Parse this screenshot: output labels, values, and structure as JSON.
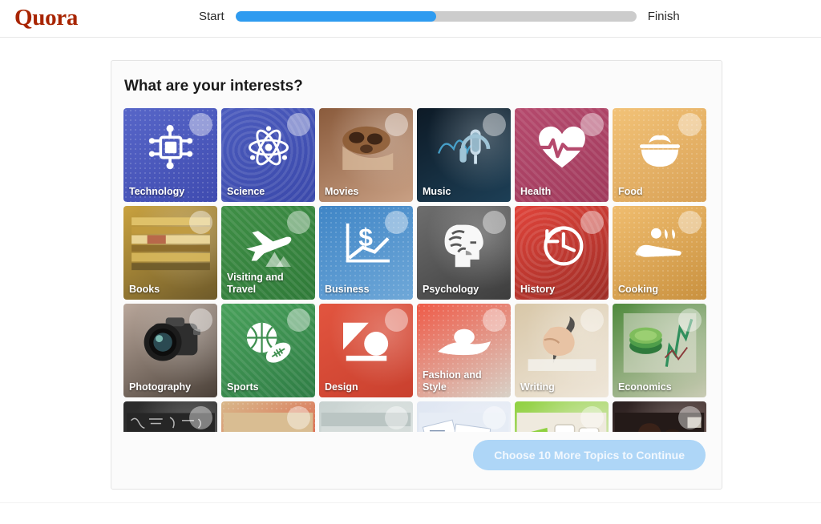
{
  "header": {
    "brand": "Quora",
    "brand_color": "#a82400",
    "progress": {
      "start_label": "Start",
      "finish_label": "Finish",
      "percent": 50,
      "fill_color": "#2e9bf0",
      "track_color": "#cccccc"
    }
  },
  "card": {
    "title": "What are your interests?",
    "continue_button": {
      "label": "Choose 10 More Topics to Continue",
      "remaining_count": 10,
      "enabled": false,
      "color": "#aed6f7"
    }
  },
  "topics": [
    {
      "label": "Technology",
      "icon": "microchip-icon",
      "bg_start": "#5766c8",
      "bg_end": "#3f4bb0",
      "texture": "tex-dots",
      "selector": "selector-circle",
      "visible": true
    },
    {
      "label": "Science",
      "icon": "atom-icon",
      "bg_start": "#4b5bbd",
      "bg_end": "#3b49ab",
      "texture": "tex-rings",
      "selector": "selector-circle",
      "visible": true
    },
    {
      "label": "Movies",
      "icon": "film-reel-photo",
      "bg_start": "#8a5b3c",
      "bg_end": "#c9a084",
      "texture": "tex-blur",
      "selector": "selector-circle",
      "visible": true
    },
    {
      "label": "Music",
      "icon": "microphone-photo",
      "bg_start": "#0d1a26",
      "bg_end": "#1d3f56",
      "texture": "tex-blur",
      "selector": "selector-circle",
      "visible": true
    },
    {
      "label": "Health",
      "icon": "heartbeat-icon",
      "bg_start": "#b54a6d",
      "bg_end": "#a03a5c",
      "texture": "tex-diag",
      "selector": "selector-circle",
      "visible": true
    },
    {
      "label": "Food",
      "icon": "rice-bowl-icon",
      "bg_start": "#f2c277",
      "bg_end": "#d9a257",
      "texture": "tex-dots",
      "selector": "selector-circle",
      "visible": true
    },
    {
      "label": "Books",
      "icon": "book-stack-photo",
      "bg_start": "#c9a23f",
      "bg_end": "#6e5a2a",
      "texture": "tex-blur",
      "selector": "selector-circle",
      "visible": true
    },
    {
      "label": "Visiting and Travel",
      "icon": "airplane-icon",
      "bg_start": "#3f8f46",
      "bg_end": "#2f7a38",
      "texture": "tex-diag",
      "selector": "selector-circle",
      "visible": true
    },
    {
      "label": "Business",
      "icon": "dollar-chart-icon",
      "bg_start": "#3f85c6",
      "bg_end": "#6fa8d8",
      "texture": "tex-dots",
      "selector": "selector-circle",
      "visible": true
    },
    {
      "label": "Psychology",
      "icon": "brain-head-icon",
      "bg_start": "#6e6e6e",
      "bg_end": "#3d3d3d",
      "texture": "tex-blur",
      "selector": "selector-circle",
      "visible": true
    },
    {
      "label": "History",
      "icon": "clock-rewind-icon",
      "bg_start": "#e0443b",
      "bg_end": "#9e2d26",
      "texture": "tex-rings",
      "selector": "selector-circle",
      "visible": true
    },
    {
      "label": "Cooking",
      "icon": "knife-icon",
      "bg_start": "#f0bd6f",
      "bg_end": "#c9913f",
      "texture": "tex-dots",
      "selector": "selector-circle",
      "visible": true
    },
    {
      "label": "Photography",
      "icon": "camera-photo",
      "bg_start": "#b9a79b",
      "bg_end": "#4a4038",
      "texture": "tex-blur",
      "selector": "selector-circle",
      "visible": true
    },
    {
      "label": "Sports",
      "icon": "ball-icon",
      "bg_start": "#48a05a",
      "bg_end": "#2f7d45",
      "texture": "tex-diag",
      "selector": "selector-circle",
      "visible": true
    },
    {
      "label": "Design",
      "icon": "shapes-icon",
      "bg_start": "#e2553f",
      "bg_end": "#c9402e",
      "texture": "tex-blur",
      "selector": "selector-circle",
      "visible": true
    },
    {
      "label": "Fashion and Style",
      "icon": "sun-hat-icon",
      "bg_start": "#ef5a47",
      "bg_end": "#d8d2c8",
      "texture": "tex-dots",
      "selector": "selector-circle",
      "visible": true
    },
    {
      "label": "Writing",
      "icon": "hand-pen-photo",
      "bg_start": "#d8c7a8",
      "bg_end": "#efe7da",
      "texture": "tex-blur",
      "selector": "selector-circle",
      "visible": true
    },
    {
      "label": "Economics",
      "icon": "coins-chart-photo",
      "bg_start": "#4f8a3d",
      "bg_end": "#c9cbb4",
      "texture": "tex-blur",
      "selector": "selector-circle",
      "visible": true
    },
    {
      "label": "",
      "icon": "chalkboard-math-photo",
      "bg_start": "#2b2b2b",
      "bg_end": "#3a3a3a",
      "texture": "tex-blur",
      "selector": "selector-circle",
      "visible": true
    },
    {
      "label": "",
      "icon": "red-texture-photo",
      "bg_start": "#d8b88a",
      "bg_end": "#e03c2e",
      "texture": "tex-dots",
      "selector": "selector-circle",
      "visible": true
    },
    {
      "label": "",
      "icon": "pale-gray-photo",
      "bg_start": "#c8d2d0",
      "bg_end": "#e2e8e6",
      "texture": "tex-blur",
      "selector": "selector-circle",
      "visible": true
    },
    {
      "label": "",
      "icon": "documents-photo",
      "bg_start": "#dfe6f2",
      "bg_end": "#eef2f8",
      "texture": "tex-blur",
      "selector": "selector-circle",
      "visible": true
    },
    {
      "label": "",
      "icon": "keyboard-photo",
      "bg_start": "#8fd13f",
      "bg_end": "#efeade",
      "texture": "tex-blur",
      "selector": "selector-circle",
      "visible": true
    },
    {
      "label": "",
      "icon": "people-photo",
      "bg_start": "#2a2020",
      "bg_end": "#6b4a42",
      "texture": "tex-blur",
      "selector": "selector-circle",
      "visible": true
    }
  ]
}
